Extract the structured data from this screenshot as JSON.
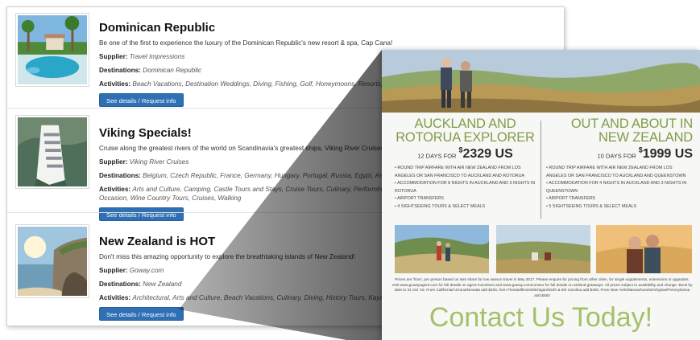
{
  "listings": [
    {
      "title": "Dominican Republic",
      "description": "Be one of the first to experience the luxury of the Dominican Republic's new resort & spa, Cap Cana!",
      "supplier_label": "Supplier:",
      "supplier": "Travel Impressions",
      "destinations_label": "Destinations:",
      "destinations": "Dominican Republic",
      "activities_label": "Activities:",
      "activities": "Beach Vacations, Destination Weddings, Diving, Fishing, Golf, Honeymoons, Resorts, Sightseeir",
      "button": "See details / Request info"
    },
    {
      "title": "Viking Specials!",
      "description": "Cruise along the greatest rivers of the world on Scandinavia's greatest ships, Viking River Cruises!",
      "supplier_label": "Supplier:",
      "supplier": "Viking River Cruises",
      "destinations_label": "Destinations:",
      "destinations": "Belgium, Czech Republic, France, Germany, Hungary, Portugal, Russia, Egypt, Asia",
      "activities_label": "Activities:",
      "activities": "Arts and Culture, Camping, Castle Tours and Stays, Cruise Tours, Culinary, Performing Arts, River Senior Citizens, Sightseeing, Singles, Special Occasion, Wine Country Tours, Cruises, Walking",
      "button": "See details / Request info"
    },
    {
      "title": "New Zealand is HOT",
      "description": "Don't miss this amazing opportunity to explore the breathtaking islands of New Zealand!",
      "supplier_label": "Supplier:",
      "supplier": "Goway.com",
      "destinations_label": "Destinations:",
      "destinations": "New Zealand",
      "activities_label": "Activities:",
      "activities": "Architectural, Arts and Culture, Beach Vacations, Culinary, Diving, History Tours, Kayaking, Natu Bicycling, Hiking - Trekking, Walking",
      "button": "See details / Request info"
    }
  ],
  "brochure": {
    "package1": {
      "name_line1": "AUCKLAND AND",
      "name_line2": "ROTORUA EXPLORER",
      "days": "12 DAYS FOR",
      "price_symbol": "$",
      "price": "2329 US",
      "features": [
        "• ROUND TRIP AIRFARE WITH AIR NEW ZEALAND FROM LOS ANGELES OR SAN FRANCISCO TO AUCKLAND AND ROTORUA",
        "• ACCOMMODATION FOR 8 NIGHTS IN AUCKLAND AND 3 NIGHTS IN ROTORUA",
        "• AIRPORT TRANSFERS",
        "• 4 SIGHTSEEING TOURS & SELECT MEALS"
      ]
    },
    "package2": {
      "name_line1": "OUT AND ABOUT IN",
      "name_line2": "NEW ZEALAND",
      "days": "10 DAYS FOR",
      "price_symbol": "$",
      "price": "1999 US",
      "features": [
        "• ROUND TRIP AIRFARE WITH AIR NEW ZEALAND FROM LOS ANGELES OR SAN FRANCISCO TO AUCKLAND AND QUEENSTOWN",
        "• ACCOMMODATION FOR 4 NIGHTS IN AUCKLAND AND 3 NIGHTS IN QUEENSTOWN",
        "• AIRPORT TRANSFERS",
        "• 5 SIGHTSEEING TOURS & SELECT MEALS"
      ]
    },
    "fine_print": "Prices are 'from', per person based on twin share for low season travel in May 2017. Please enquire for pricing from other cities, for single supplements, extensions or upgrades. Visit www.gowayagent.com for full details on agent incentives and www.goway.com/conseo for full details on air/land getaways. All prices subject to availability and change. Book by date to 31 Oct '16. From California/Arizona/Nevada add $200, from Florida/Illinois/Michigan/Ninth & 5th Carolina add $400, From New York/Massachusetts/Virginia/Pennsylvania add $450",
    "contact": "Contact Us Today!"
  },
  "colors": {
    "accent_green": "#7f9d49",
    "contact_green": "#a3c16a",
    "button_blue": "#2f6fb3"
  }
}
